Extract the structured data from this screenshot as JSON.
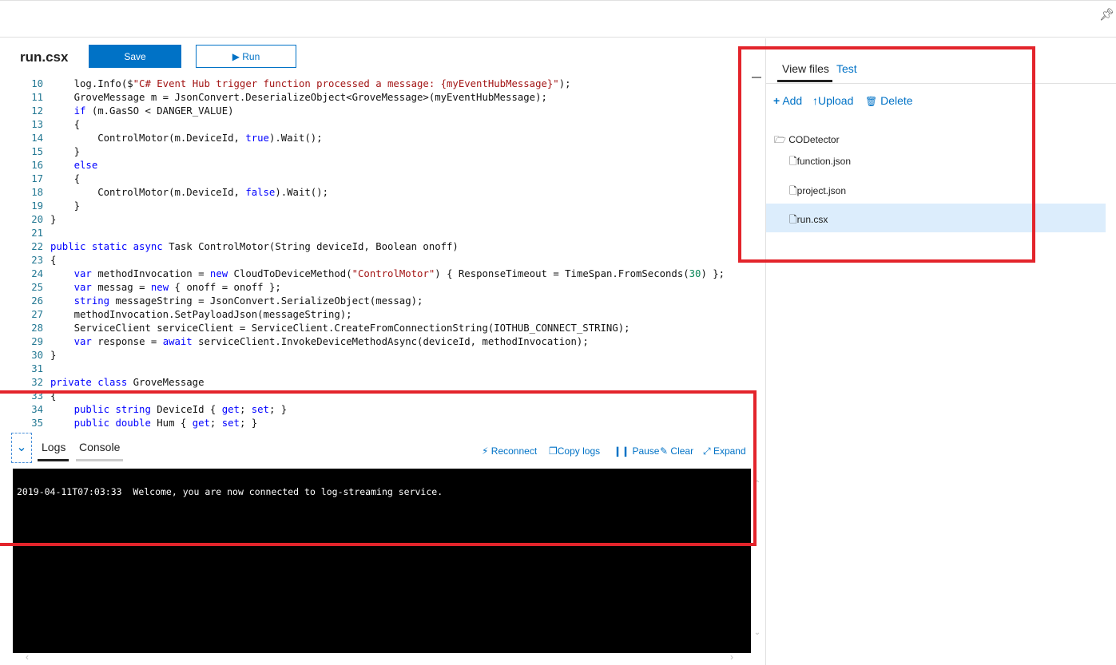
{
  "editor": {
    "filename": "run.csx",
    "save_label": "Save",
    "run_label": "▶ Run",
    "lines": [
      {
        "n": "10",
        "parts": [
          [
            "    log.Info($",
            ""
          ],
          [
            "\"C# Event Hub trigger function processed a message: {myEventHubMessage}\"",
            "str"
          ],
          [
            ");",
            ""
          ]
        ]
      },
      {
        "n": "11",
        "parts": [
          [
            "    GroveMessage m = JsonConvert.DeserializeObject<GroveMessage>(myEventHubMessage);",
            ""
          ]
        ]
      },
      {
        "n": "12",
        "parts": [
          [
            "    ",
            ""
          ],
          [
            "if",
            "kw"
          ],
          [
            " (m.GasSO < DANGER_VALUE)",
            ""
          ]
        ]
      },
      {
        "n": "13",
        "parts": [
          [
            "    {",
            ""
          ]
        ]
      },
      {
        "n": "14",
        "parts": [
          [
            "        ControlMotor(m.DeviceId, ",
            ""
          ],
          [
            "true",
            "kw"
          ],
          [
            ").Wait();",
            ""
          ]
        ]
      },
      {
        "n": "15",
        "parts": [
          [
            "    }",
            ""
          ]
        ]
      },
      {
        "n": "16",
        "parts": [
          [
            "    ",
            ""
          ],
          [
            "else",
            "kw"
          ]
        ]
      },
      {
        "n": "17",
        "parts": [
          [
            "    {",
            ""
          ]
        ]
      },
      {
        "n": "18",
        "parts": [
          [
            "        ControlMotor(m.DeviceId, ",
            ""
          ],
          [
            "false",
            "kw"
          ],
          [
            ").Wait();",
            ""
          ]
        ]
      },
      {
        "n": "19",
        "parts": [
          [
            "    }",
            ""
          ]
        ]
      },
      {
        "n": "20",
        "parts": [
          [
            "}",
            ""
          ]
        ]
      },
      {
        "n": "21",
        "parts": []
      },
      {
        "n": "22",
        "parts": [
          [
            "public static async",
            "kw"
          ],
          [
            " Task ControlMotor(String deviceId, Boolean onoff)",
            ""
          ]
        ]
      },
      {
        "n": "23",
        "parts": [
          [
            "{",
            ""
          ]
        ]
      },
      {
        "n": "24",
        "parts": [
          [
            "    ",
            ""
          ],
          [
            "var",
            "kw"
          ],
          [
            " methodInvocation = ",
            ""
          ],
          [
            "new",
            "kw"
          ],
          [
            " CloudToDeviceMethod(",
            ""
          ],
          [
            "\"ControlMotor\"",
            "str"
          ],
          [
            ") { ResponseTimeout = TimeSpan.FromSeconds(",
            ""
          ],
          [
            "30",
            "num"
          ],
          [
            ") };",
            ""
          ]
        ]
      },
      {
        "n": "25",
        "parts": [
          [
            "    ",
            ""
          ],
          [
            "var",
            "kw"
          ],
          [
            " messag = ",
            ""
          ],
          [
            "new",
            "kw"
          ],
          [
            " { onoff = onoff };",
            ""
          ]
        ]
      },
      {
        "n": "26",
        "parts": [
          [
            "    ",
            ""
          ],
          [
            "string",
            "kw"
          ],
          [
            " messageString = JsonConvert.SerializeObject(messag);",
            ""
          ]
        ]
      },
      {
        "n": "27",
        "parts": [
          [
            "    methodInvocation.SetPayloadJson(messageString);",
            ""
          ]
        ]
      },
      {
        "n": "28",
        "parts": [
          [
            "    ServiceClient serviceClient = ServiceClient.CreateFromConnectionString(IOTHUB_CONNECT_STRING);",
            ""
          ]
        ]
      },
      {
        "n": "29",
        "parts": [
          [
            "    ",
            ""
          ],
          [
            "var",
            "kw"
          ],
          [
            " response = ",
            ""
          ],
          [
            "await",
            "kw"
          ],
          [
            " serviceClient.InvokeDeviceMethodAsync(deviceId, methodInvocation);",
            ""
          ]
        ]
      },
      {
        "n": "30",
        "parts": [
          [
            "}",
            ""
          ]
        ]
      },
      {
        "n": "31",
        "parts": []
      },
      {
        "n": "32",
        "parts": [
          [
            "private class",
            "kw"
          ],
          [
            " GroveMessage",
            ""
          ]
        ]
      },
      {
        "n": "33",
        "parts": [
          [
            "{",
            ""
          ]
        ]
      },
      {
        "n": "34",
        "parts": [
          [
            "    ",
            ""
          ],
          [
            "public string",
            "kw"
          ],
          [
            " DeviceId { ",
            ""
          ],
          [
            "get",
            "kw"
          ],
          [
            "; ",
            ""
          ],
          [
            "set",
            "kw"
          ],
          [
            "; }",
            ""
          ]
        ]
      },
      {
        "n": "35",
        "parts": [
          [
            "    ",
            ""
          ],
          [
            "public double",
            "kw"
          ],
          [
            " Hum { ",
            ""
          ],
          [
            "get",
            "kw"
          ],
          [
            "; ",
            ""
          ],
          [
            "set",
            "kw"
          ],
          [
            "; }",
            ""
          ]
        ]
      }
    ]
  },
  "files_panel": {
    "tabs": [
      "View files",
      "Test"
    ],
    "actions": [
      "Add",
      "Upload",
      "Delete"
    ],
    "folder": "CODetector",
    "files": [
      "function.json",
      "project.json",
      "run.csx"
    ],
    "selected_file": "run.csx"
  },
  "logs_panel": {
    "tabs": [
      "Logs",
      "Console"
    ],
    "actions": [
      "Reconnect",
      "Copy logs",
      "Pause",
      "Clear",
      "Expand"
    ],
    "log_lines": [
      "2019-04-11T07:03:33  Welcome, you are now connected to log-streaming service."
    ]
  },
  "colors": {
    "accent": "#0072c6",
    "highlight_box": "#e3242b",
    "selected_row": "#dcedfc"
  }
}
